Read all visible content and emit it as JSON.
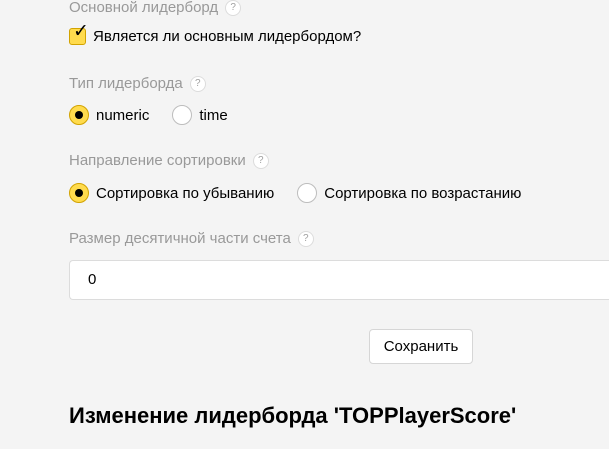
{
  "main_leaderboard": {
    "label": "Основной лидерборд",
    "help_glyph": "?",
    "checkbox_label": "Является ли основным лидербордом?",
    "checked": true
  },
  "leaderboard_type": {
    "label": "Тип лидерборда",
    "help_glyph": "?",
    "options": [
      {
        "label": "numeric",
        "selected": true
      },
      {
        "label": "time",
        "selected": false
      }
    ]
  },
  "sort_direction": {
    "label": "Направление сортировки",
    "help_glyph": "?",
    "options": [
      {
        "label": "Сортировка по убыванию",
        "selected": true
      },
      {
        "label": "Сортировка по возрастанию",
        "selected": false
      }
    ]
  },
  "decimal_part": {
    "label": "Размер десятичной части счета",
    "help_glyph": "?",
    "value": "0"
  },
  "actions": {
    "save_label": "Сохранить"
  },
  "edit_section": {
    "heading": "Изменение лидерборда 'TOPPlayerScore'"
  },
  "colors": {
    "accent": "#ffdb4d",
    "label_gray": "#999999",
    "background": "#f4f4f4"
  }
}
